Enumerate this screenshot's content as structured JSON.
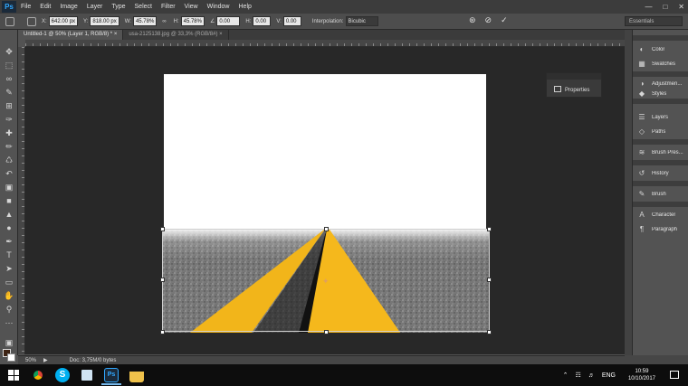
{
  "app": {
    "logo": "Ps"
  },
  "menubar": {
    "items": [
      "File",
      "Edit",
      "Image",
      "Layer",
      "Type",
      "Select",
      "Filter",
      "View",
      "Window",
      "Help"
    ]
  },
  "options": {
    "x_label": "X:",
    "x_value": "642.00 px",
    "y_label": "Y:",
    "y_value": "818.00 px",
    "w_label": "W:",
    "w_value": "45.78%",
    "h_label": "H:",
    "h_value": "45.78%",
    "angle_value": "0.00",
    "hskew_label": "H:",
    "hskew_value": "0.00",
    "vskew_label": "V:",
    "vskew_value": "0.00",
    "interp_label": "Interpolation:",
    "interp_value": "Bicubic",
    "workspace": "Essentials"
  },
  "tabs": [
    {
      "label": "Untitled-1 @ 50% (Layer 1, RGB/8) *",
      "active": true
    },
    {
      "label": "usa-2125138.jpg @ 33,3% (RGB/8#)",
      "active": false
    }
  ],
  "properties_panel": {
    "label": "Properties"
  },
  "dock": {
    "group1": [
      {
        "icon": "color-wheel-icon",
        "label": "Color"
      },
      {
        "icon": "swatches-icon",
        "label": "Swatches"
      }
    ],
    "group2": [
      {
        "icon": "adjustments-icon",
        "label": "Adjustmen..."
      },
      {
        "icon": "styles-icon",
        "label": "Styles"
      }
    ],
    "group3": [
      {
        "icon": "layers-icon",
        "label": "Layers"
      },
      {
        "icon": "paths-icon",
        "label": "Paths"
      }
    ],
    "group4": [
      {
        "icon": "brush-presets-icon",
        "label": "Brush Pres..."
      }
    ],
    "group5": [
      {
        "icon": "history-icon",
        "label": "History"
      }
    ],
    "group6": [
      {
        "icon": "brush-icon",
        "label": "Brush"
      }
    ],
    "group7": [
      {
        "icon": "character-icon",
        "label": "Character"
      },
      {
        "icon": "paragraph-icon",
        "label": "Paragraph"
      }
    ]
  },
  "status": {
    "zoom": "50%",
    "doc": "Doc: 3,75M/0 bytes"
  },
  "taskbar": {
    "lang": "ENG",
    "time": "10:59",
    "date": "10/10/2017"
  },
  "colors": {
    "foreground": "#3d2313",
    "background": "#ffffff",
    "accent": "#31a8ff"
  }
}
